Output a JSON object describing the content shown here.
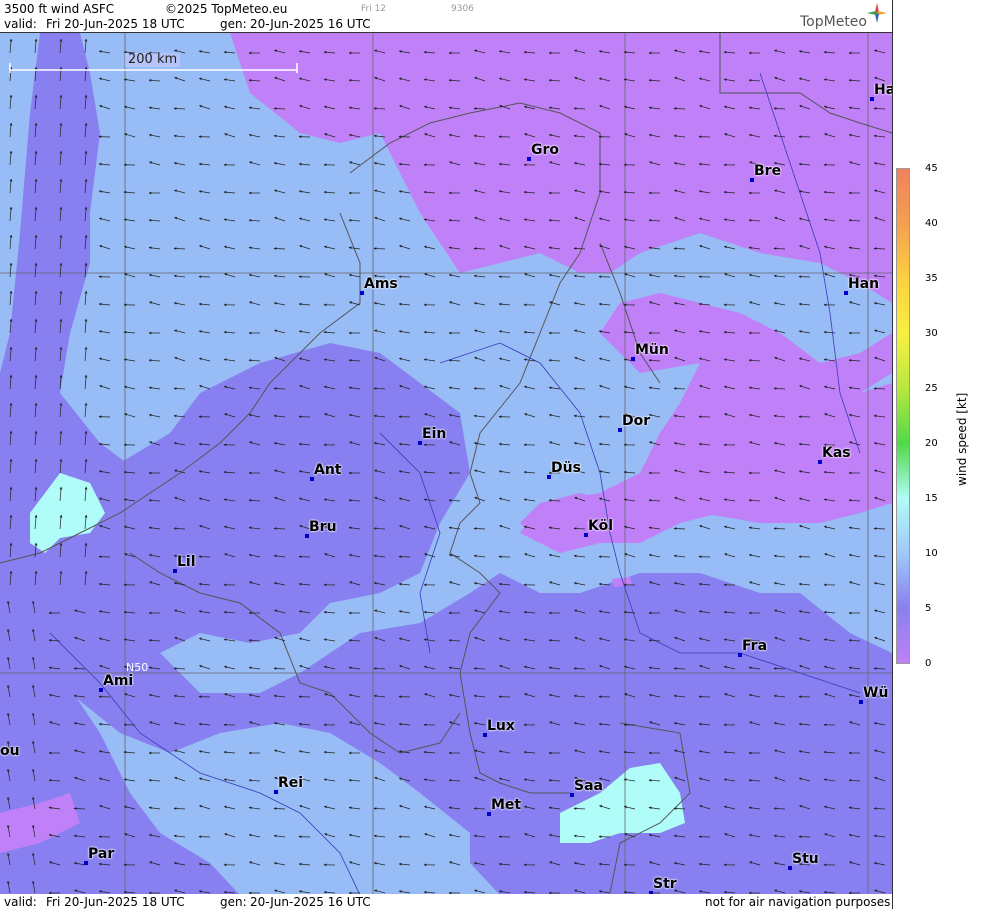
{
  "header": {
    "product": "3500 ft wind ASFC",
    "copyright": "©2025 TopMeteo.eu",
    "valid_label": "valid:",
    "valid": "Fri  20-Jun-2025  18 UTC",
    "gen_label": "gen:",
    "gen": "20-Jun-2025 16 UTC",
    "run_small": "Fri 12",
    "code_small": "9306",
    "brand": "TopMeteo"
  },
  "footer": {
    "valid_label": "valid:",
    "valid": "Fri  20-Jun-2025  18 UTC",
    "gen_label": "gen:",
    "gen": "20-Jun-2025 16 UTC",
    "disclaimer": "not for air navigation purposes"
  },
  "map": {
    "scale_label": "200 km",
    "latitude_label": "N50",
    "cities": [
      {
        "name": "Ha"
      },
      {
        "name": "Gro"
      },
      {
        "name": "Bre"
      },
      {
        "name": "Ams"
      },
      {
        "name": "Han"
      },
      {
        "name": "Mün"
      },
      {
        "name": "Dor"
      },
      {
        "name": "Ein"
      },
      {
        "name": "Kas"
      },
      {
        "name": "Düs"
      },
      {
        "name": "Ant"
      },
      {
        "name": "Köl"
      },
      {
        "name": "Bru"
      },
      {
        "name": "Lil"
      },
      {
        "name": "Fra"
      },
      {
        "name": "Ami"
      },
      {
        "name": "Wü"
      },
      {
        "name": "ou"
      },
      {
        "name": "Lux"
      },
      {
        "name": "Rei"
      },
      {
        "name": "Saa"
      },
      {
        "name": "Met"
      },
      {
        "name": "Par"
      },
      {
        "name": "Stu"
      },
      {
        "name": "Str"
      }
    ]
  },
  "legend": {
    "title": "wind  speed  [kt]",
    "ticks": [
      "45",
      "40",
      "35",
      "30",
      "25",
      "20",
      "15",
      "10",
      "5",
      "0"
    ],
    "colors": [
      "#f08060",
      "#f4a050",
      "#fcd040",
      "#f8f040",
      "#b8e840",
      "#50d848",
      "#b0fcf8",
      "#a0c8f8",
      "#8880f0",
      "#c080f8"
    ]
  },
  "colors": {
    "calm": "#c080f8",
    "light": "#8880f0",
    "moderate": "#98bcf6",
    "fresh": "#b0fcf8"
  }
}
